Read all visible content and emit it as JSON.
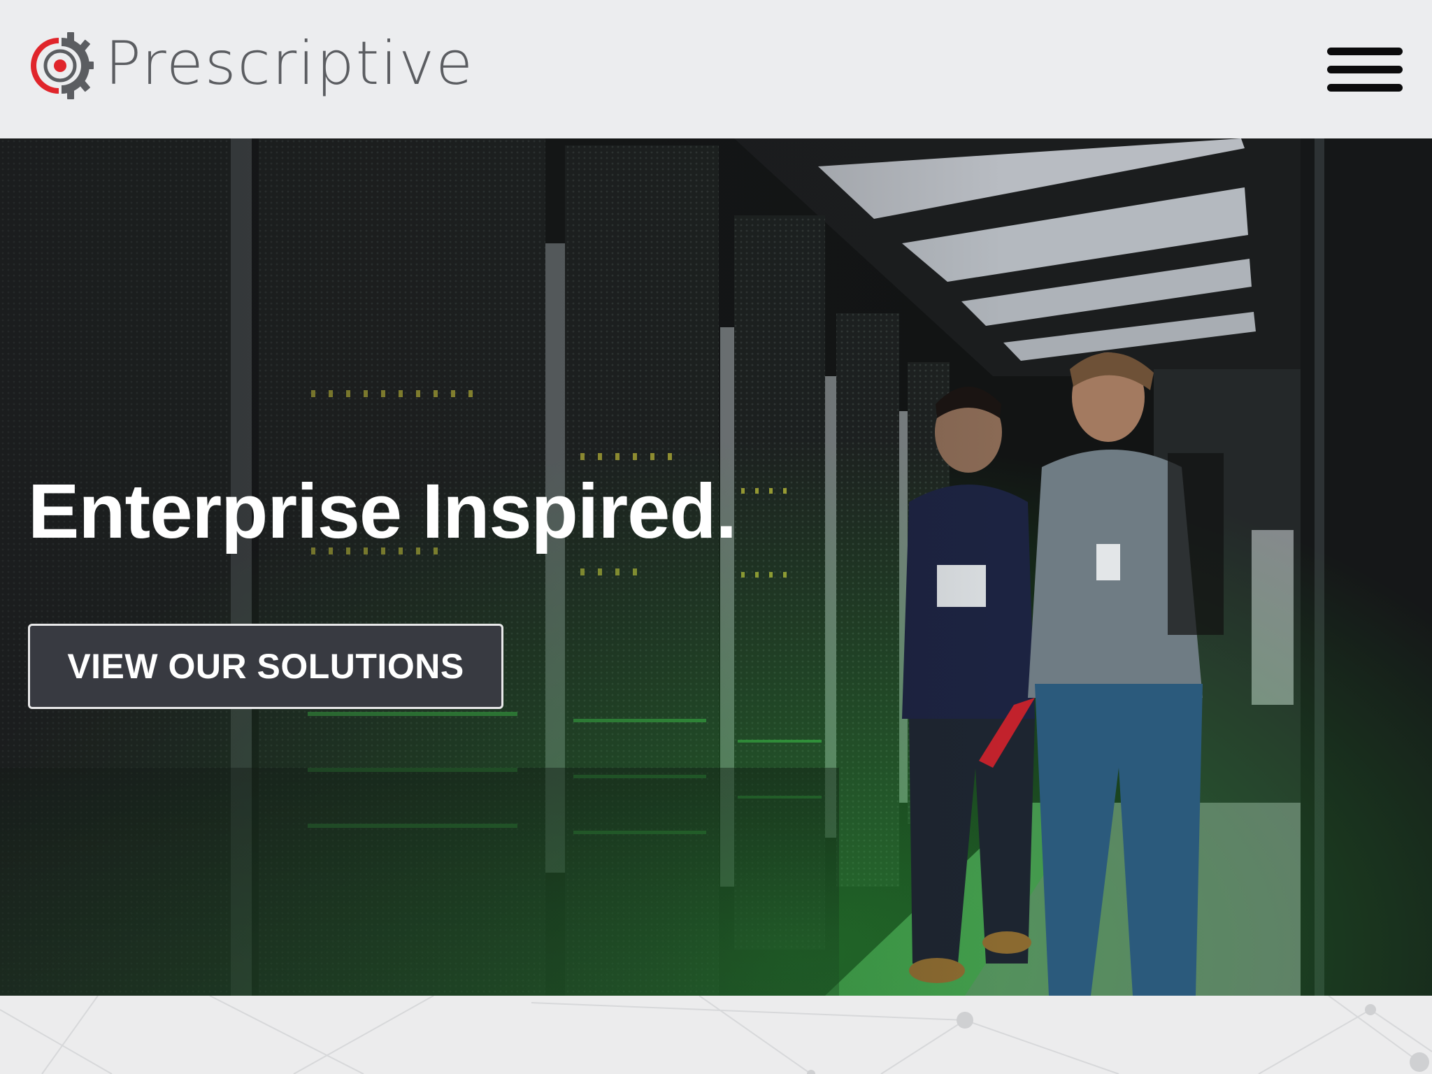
{
  "header": {
    "logo_text": "Prescriptive",
    "menu_icon": "hamburger-menu-icon",
    "brand_colors": {
      "red": "#e0252b",
      "gray": "#5b5d61"
    }
  },
  "hero": {
    "title": "Enterprise Inspired.",
    "cta_label": "VIEW OUR SOLUTIONS",
    "background": "data-center-photo"
  }
}
